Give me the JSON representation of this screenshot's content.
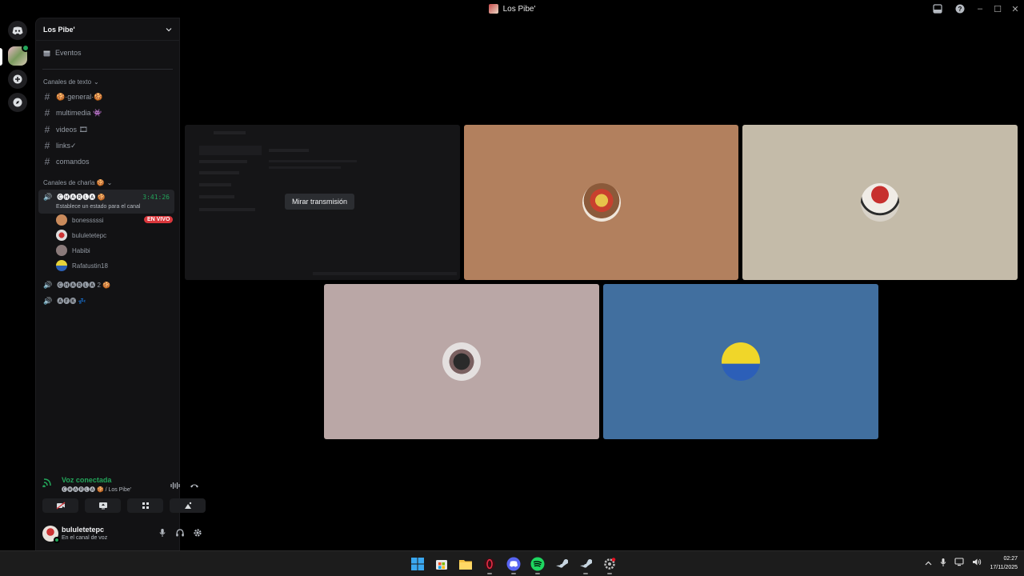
{
  "window": {
    "title": "Los Pibe'"
  },
  "server": {
    "name": "Los Pibe'",
    "events_label": "Eventos"
  },
  "text_category": "Canales de texto",
  "text_channels": [
    {
      "name": "🍪·general·🍪"
    },
    {
      "name": "multimedia 👾"
    },
    {
      "name": "videos 🎞"
    },
    {
      "name": "links✓"
    },
    {
      "name": "comandos"
    }
  ],
  "voice_category": "Canales de charla 🍪",
  "active_voice": {
    "name": "🅒🅗🅐🅡🅛🅐 🍪",
    "timer": "3:41:26",
    "status": "Establece un estado para el canal"
  },
  "members": [
    {
      "name": "bonesssssi",
      "live": "EN VIVO"
    },
    {
      "name": "bululetetepc"
    },
    {
      "name": "Habibi"
    },
    {
      "name": "Rafatustin18"
    }
  ],
  "other_voice": [
    {
      "name": "🅒🅗🅐🅡🅛🅐 2 🍪"
    },
    {
      "name": "🅐🅕🅚 💤"
    }
  ],
  "voice_panel": {
    "title": "Voz conectada",
    "subtitle": "🅒🅗🅐🅡🅛🅐 🍪 / Los Pibe'"
  },
  "user": {
    "name": "bululetetepc",
    "status": "En el canal de voz"
  },
  "stage": {
    "watch_label": "Mirar transmisión"
  },
  "taskbar": {
    "time": "02:27",
    "date": "17/11/2025"
  }
}
